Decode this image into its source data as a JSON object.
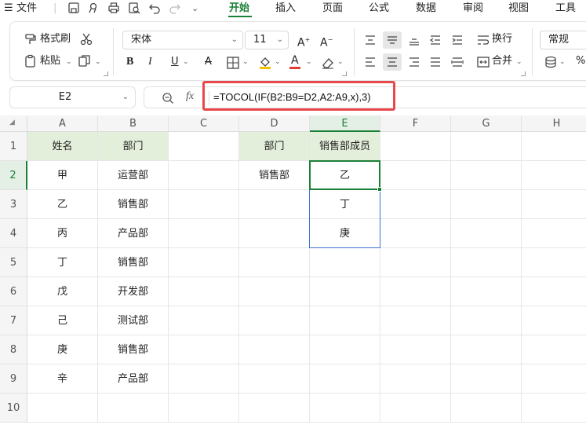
{
  "menu": {
    "file_label": "文件",
    "tabs": [
      {
        "label": "开始",
        "active": true
      },
      {
        "label": "插入"
      },
      {
        "label": "页面"
      },
      {
        "label": "公式"
      },
      {
        "label": "数据"
      },
      {
        "label": "审阅"
      },
      {
        "label": "视图"
      },
      {
        "label": "工具"
      }
    ]
  },
  "ribbon": {
    "format_painter": "格式刷",
    "paste": "粘贴",
    "font_name": "宋体",
    "font_size": "11",
    "wrap": "换行",
    "merge": "合并",
    "number_format": "常规",
    "percent": "%"
  },
  "formula_bar": {
    "name_box": "E2",
    "fx_label": "fx",
    "formula": "=TOCOL(IF(B2:B9=D2,A2:A9,x),3)"
  },
  "sheet": {
    "columns": [
      "A",
      "B",
      "C",
      "D",
      "E",
      "F",
      "G",
      "H"
    ],
    "rows": [
      "1",
      "2",
      "3",
      "4",
      "5",
      "6",
      "7",
      "8",
      "9",
      "10"
    ],
    "selected_cell": "E2",
    "cells": {
      "A1": "姓名",
      "B1": "部门",
      "D1": "部门",
      "E1": "销售部成员",
      "A2": "甲",
      "B2": "运营部",
      "D2": "销售部",
      "E2": "乙",
      "A3": "乙",
      "B3": "销售部",
      "E3": "丁",
      "A4": "丙",
      "B4": "产品部",
      "E4": "庚",
      "A5": "丁",
      "B5": "销售部",
      "A6": "戊",
      "B6": "开发部",
      "A7": "己",
      "B7": "测试部",
      "A8": "庚",
      "B8": "销售部",
      "A9": "辛",
      "B9": "产品部"
    }
  },
  "colors": {
    "accent": "#1a7f37",
    "header_fill": "#e4efdb",
    "highlight_box": "#e8474b",
    "spill_border": "#3b6fd6"
  }
}
